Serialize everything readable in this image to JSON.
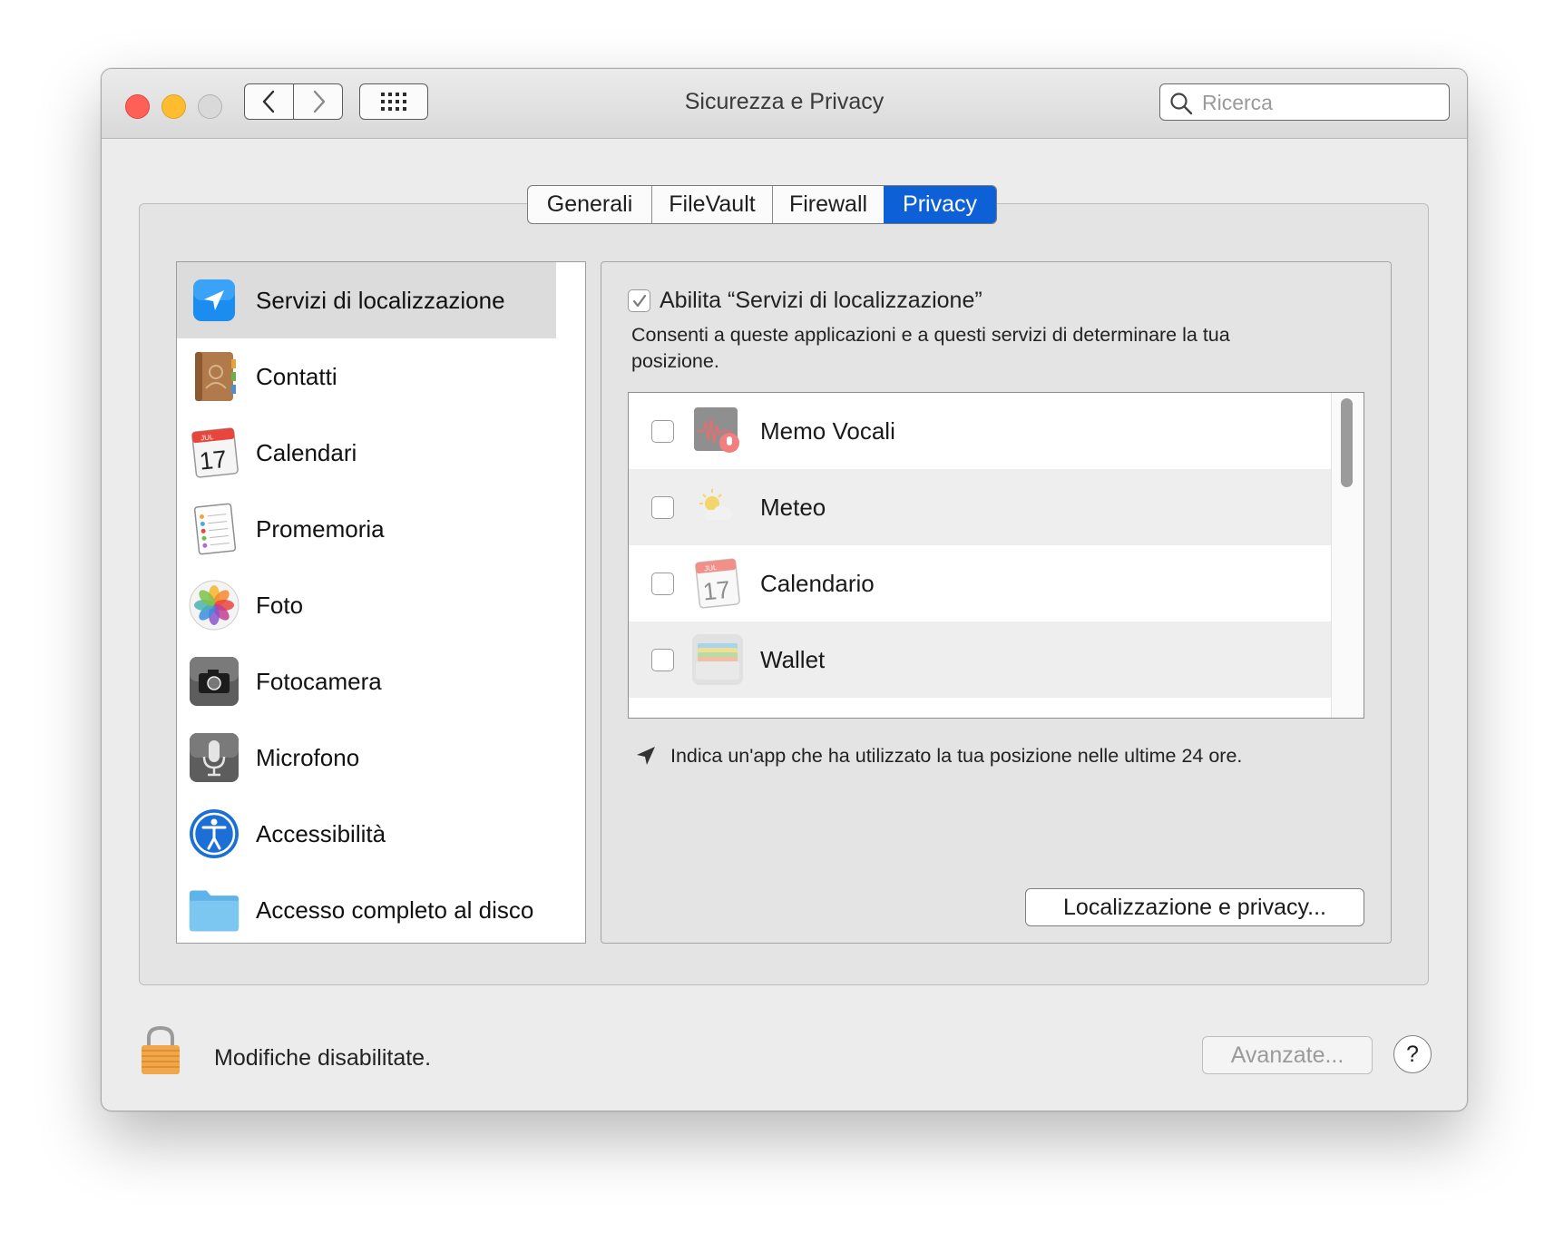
{
  "window": {
    "title": "Sicurezza e Privacy",
    "search_placeholder": "Ricerca"
  },
  "tabs": [
    {
      "label": "Generali"
    },
    {
      "label": "FileVault"
    },
    {
      "label": "Firewall"
    },
    {
      "label": "Privacy",
      "active": true
    }
  ],
  "sidebar": {
    "items": [
      {
        "label": "Servizi di localizzazione",
        "icon": "location-arrow-icon",
        "selected": true
      },
      {
        "label": "Contatti",
        "icon": "contacts-book-icon"
      },
      {
        "label": "Calendari",
        "icon": "calendar-icon"
      },
      {
        "label": "Promemoria",
        "icon": "reminders-icon"
      },
      {
        "label": "Foto",
        "icon": "photos-flower-icon"
      },
      {
        "label": "Fotocamera",
        "icon": "camera-icon"
      },
      {
        "label": "Microfono",
        "icon": "microphone-icon"
      },
      {
        "label": "Accessibilità",
        "icon": "accessibility-icon"
      },
      {
        "label": "Accesso completo al disco",
        "icon": "folder-icon"
      }
    ]
  },
  "panel": {
    "enable_label": "Abilita “Servizi di localizzazione”",
    "enable_checked": true,
    "description": "Consenti a queste applicazioni e a questi servizi di determinare la tua posizione.",
    "apps": [
      {
        "label": "Memo Vocali",
        "icon": "voice-memos-icon",
        "checked": false
      },
      {
        "label": "Meteo",
        "icon": "weather-icon",
        "checked": false
      },
      {
        "label": "Calendario",
        "icon": "calendar-icon",
        "checked": false
      },
      {
        "label": "Wallet",
        "icon": "wallet-icon",
        "checked": false
      }
    ],
    "hint": "Indica un'app che ha utilizzato la tua posizione nelle ultime 24 ore.",
    "privacy_button": "Localizzazione e privacy..."
  },
  "calendar_icon": {
    "month": "JUL",
    "day": "17"
  },
  "footer": {
    "lock_text": "Modifiche disabilitate.",
    "advanced_button": "Avanzate...",
    "help_label": "?"
  },
  "colors": {
    "accent": "#0d60d6",
    "close": "#fe5f57",
    "minimize": "#febc2e"
  }
}
